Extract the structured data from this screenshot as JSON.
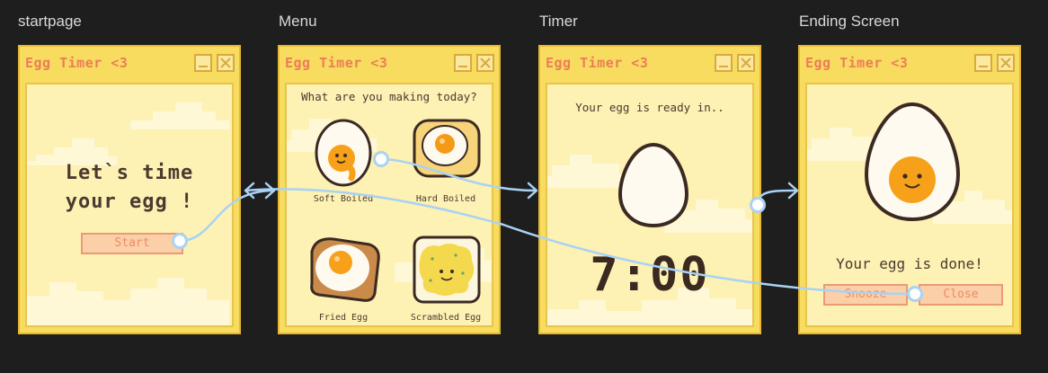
{
  "frames": [
    {
      "label": "startpage"
    },
    {
      "label": "Menu"
    },
    {
      "label": "Timer"
    },
    {
      "label": "Ending Screen"
    }
  ],
  "window": {
    "title": "Egg Timer <3"
  },
  "startpage": {
    "heading_line1": "Let`s time",
    "heading_line2": "your egg !",
    "start_label": "Start"
  },
  "menu": {
    "question": "What are you making today?",
    "items": [
      {
        "label": "Soft Boiled"
      },
      {
        "label": "Hard Boiled"
      },
      {
        "label": "Fried Egg"
      },
      {
        "label": "Scrambled Egg"
      }
    ]
  },
  "timer": {
    "message": "Your egg is ready in..",
    "time": "7:00"
  },
  "ending": {
    "message": "Your egg is done!",
    "snooze_label": "Snooze",
    "close_label": "Close"
  },
  "colors": {
    "canvas": "#1e1e1e",
    "window_yellow": "#f7dc60",
    "content_cream": "#fdf1b3",
    "title_coral": "#ec7d58",
    "button_peach": "#fbd0a8",
    "flow_blue": "#a9d2f5"
  },
  "icons": [
    "minimize-icon",
    "close-icon",
    "flow-arrow-icon",
    "soft-boiled-egg-icon",
    "hard-boiled-egg-icon",
    "fried-egg-icon",
    "scrambled-egg-icon",
    "whole-egg-icon",
    "happy-egg-icon"
  ]
}
